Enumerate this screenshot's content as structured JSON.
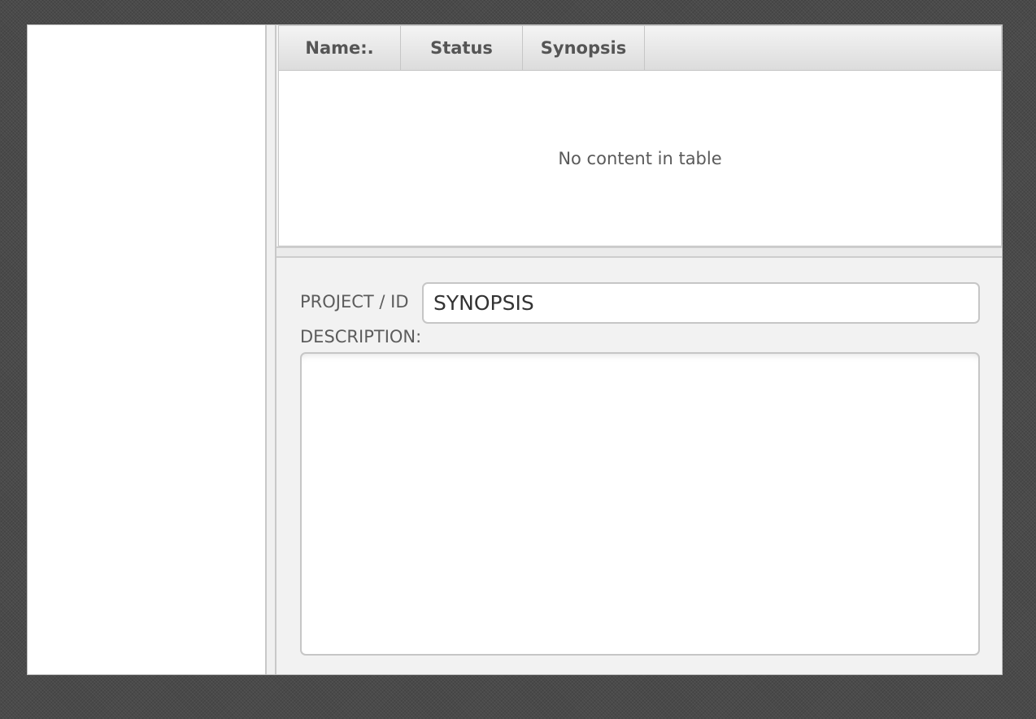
{
  "table": {
    "columns": [
      "Name:.",
      "Status",
      "Synopsis"
    ],
    "empty_message": "No content in table"
  },
  "form": {
    "project_label": "PROJECT / ID",
    "project_value": "SYNOPSIS",
    "description_label": "DESCRIPTION:",
    "description_value": ""
  }
}
